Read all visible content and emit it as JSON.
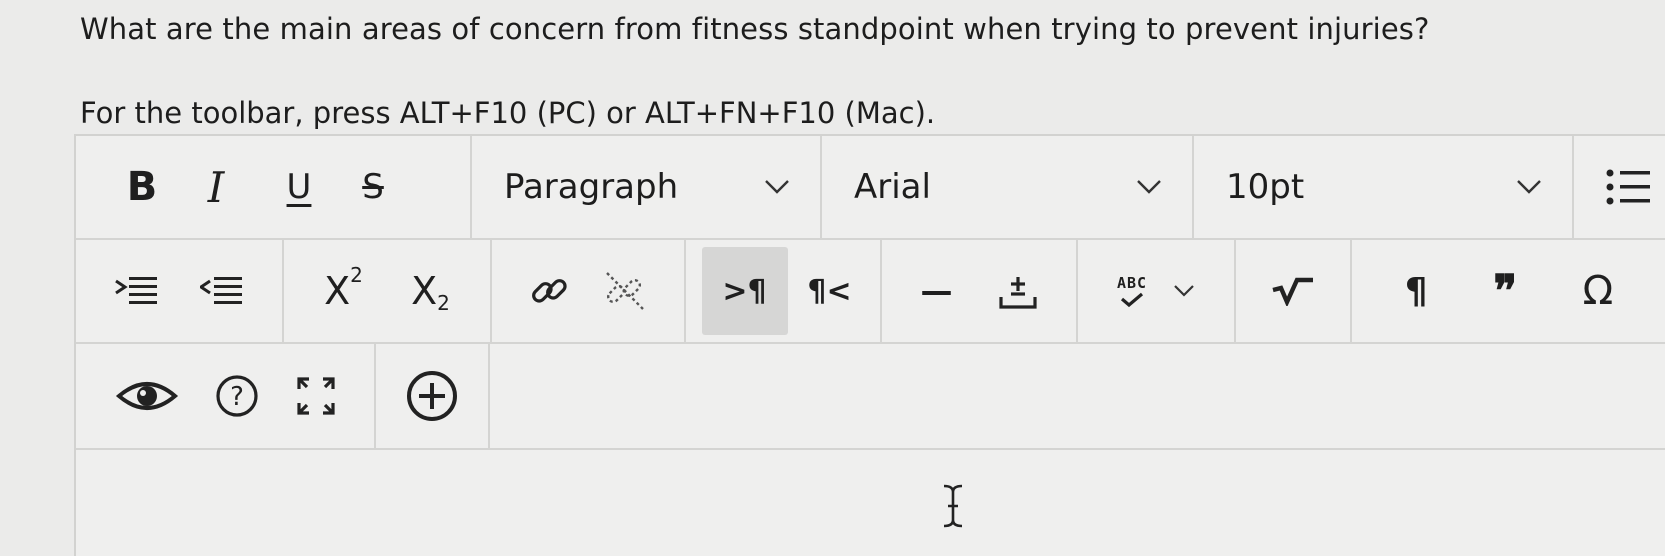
{
  "question": "What are the main areas of concern from fitness standpoint when trying to prevent injuries?",
  "hint": "For the toolbar, press ALT+F10 (PC) or ALT+FN+F10 (Mac).",
  "toolbar": {
    "bold": "B",
    "italic": "I",
    "underline": "U",
    "strike": "S",
    "paragraph": "Paragraph",
    "font": "Arial",
    "size": "10pt",
    "superscript_base": "X",
    "superscript_exp": "2",
    "subscript_base": "X",
    "subscript_sub": "2",
    "ltr": ">¶",
    "rtl": "¶<",
    "hr": "—",
    "spell": "ABC",
    "para_mark": "¶",
    "quote": "❞",
    "omega": "Ω"
  },
  "icons": [
    "bullet-list-icon",
    "indent-icon",
    "outdent-icon",
    "link-icon",
    "unlink-icon",
    "plus-minus-icon",
    "spellcheck-icon",
    "math-icon",
    "preview-icon",
    "help-icon",
    "fullscreen-icon",
    "add-icon",
    "text-cursor-icon"
  ]
}
